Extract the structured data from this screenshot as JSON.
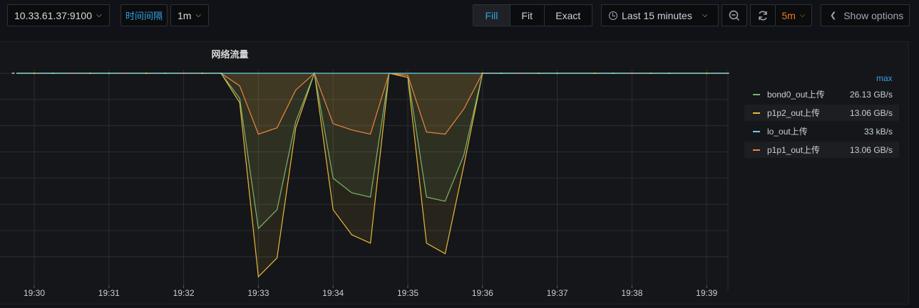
{
  "toolbar": {
    "instance": "10.33.61.37:9100",
    "interval_label": "时间间隔",
    "interval_value": "1m",
    "modes": [
      "Fill",
      "Fit",
      "Exact"
    ],
    "active_mode": "Fill",
    "time_range": "Last 15 minutes",
    "refresh_interval": "5m",
    "show_options": "Show options",
    "icons": {
      "instance": "chevron-down-icon",
      "time": "clock-icon",
      "zoom": "zoom-out-icon",
      "refresh": "refresh-icon",
      "options": "chevron-left-icon"
    }
  },
  "panel": {
    "title": "网络流量"
  },
  "legend": {
    "header": "max",
    "items": [
      {
        "name": "bond0_out上传",
        "max": "26.13 GB/s",
        "color": "#7eb26d"
      },
      {
        "name": "p1p2_out上传",
        "max": "13.06 GB/s",
        "color": "#eab839"
      },
      {
        "name": "lo_out上传",
        "max": "33 kB/s",
        "color": "#6ed0e0"
      },
      {
        "name": "p1p1_out上传",
        "max": "13.06 GB/s",
        "color": "#ef843c"
      }
    ]
  },
  "chart_data": {
    "type": "area",
    "title": "网络流量",
    "x_ticks": [
      "19:30",
      "19:31",
      "19:32",
      "19:33",
      "19:34",
      "19:35",
      "19:36",
      "19:37",
      "19:38",
      "19:39"
    ],
    "xlim": [
      "19:29:42",
      "19:39:15"
    ],
    "y_axis": "level relative to the series maximum (1 = top line); y tick labels not visible",
    "ylim": [
      0,
      1
    ],
    "grid": true,
    "x_unit": "minutes after 19:30",
    "series": [
      {
        "name": "bond0_out上传",
        "color": "#7eb26d",
        "points": [
          [
            -0.3,
            1
          ],
          [
            2.5,
            1
          ],
          [
            2.75,
            0.88
          ],
          [
            3.0,
            0.26
          ],
          [
            3.25,
            0.35
          ],
          [
            3.5,
            0.77
          ],
          [
            3.75,
            1
          ],
          [
            4.0,
            0.5
          ],
          [
            4.25,
            0.43
          ],
          [
            4.5,
            0.41
          ],
          [
            4.75,
            1
          ],
          [
            5.0,
            0.99
          ],
          [
            5.25,
            0.41
          ],
          [
            5.5,
            0.39
          ],
          [
            5.75,
            0.61
          ],
          [
            6.0,
            1
          ],
          [
            9.3,
            1
          ]
        ]
      },
      {
        "name": "p1p2_out上传",
        "color": "#eab839",
        "points": [
          [
            -0.3,
            1
          ],
          [
            2.5,
            1
          ],
          [
            2.75,
            0.86
          ],
          [
            3.0,
            0.03
          ],
          [
            3.25,
            0.12
          ],
          [
            3.5,
            0.74
          ],
          [
            3.75,
            1
          ],
          [
            4.0,
            0.35
          ],
          [
            4.25,
            0.23
          ],
          [
            4.5,
            0.19
          ],
          [
            4.75,
            1
          ],
          [
            5.0,
            0.98
          ],
          [
            5.25,
            0.19
          ],
          [
            5.5,
            0.14
          ],
          [
            5.75,
            0.56
          ],
          [
            6.0,
            1
          ],
          [
            9.3,
            1
          ]
        ]
      },
      {
        "name": "lo_out上传",
        "color": "#6ed0e0",
        "points": [
          [
            -0.3,
            1
          ],
          [
            2.5,
            1
          ],
          [
            3.75,
            1
          ],
          [
            4.75,
            1
          ],
          [
            6.0,
            1
          ],
          [
            9.3,
            1
          ]
        ]
      },
      {
        "name": "p1p1_out上传",
        "color": "#ef843c",
        "points": [
          [
            -0.3,
            1
          ],
          [
            2.5,
            1
          ],
          [
            2.75,
            0.94
          ],
          [
            3.0,
            0.71
          ],
          [
            3.25,
            0.74
          ],
          [
            3.5,
            0.92
          ],
          [
            3.75,
            1
          ],
          [
            4.0,
            0.76
          ],
          [
            4.25,
            0.73
          ],
          [
            4.5,
            0.71
          ],
          [
            4.75,
            1
          ],
          [
            5.0,
            0.99
          ],
          [
            5.25,
            0.72
          ],
          [
            5.5,
            0.71
          ],
          [
            5.75,
            0.83
          ],
          [
            6.0,
            1
          ],
          [
            9.3,
            1
          ]
        ]
      }
    ]
  }
}
